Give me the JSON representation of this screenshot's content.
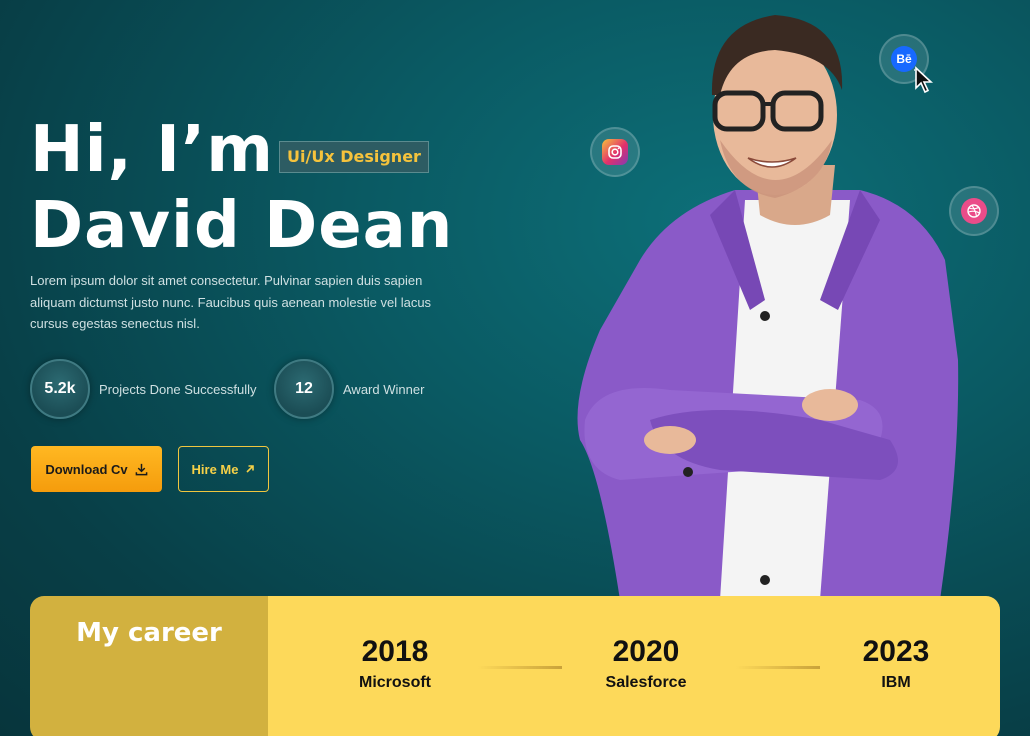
{
  "hero": {
    "greeting": "Hi, I’m",
    "name": "David Dean",
    "role": "Ui/Ux Designer",
    "intro": "Lorem ipsum dolor sit amet consectetur. Pulvinar sapien duis sapien aliquam dictumst justo nunc. Faucibus quis aenean molestie vel lacus cursus egestas senectus nisl."
  },
  "stats": [
    {
      "value": "5.2k",
      "label": "Projects Done Successfully"
    },
    {
      "value": "12",
      "label": "Award Winner"
    }
  ],
  "buttons": {
    "download": "Download Cv",
    "hire": "Hire Me"
  },
  "social": {
    "behance_label": "Bē"
  },
  "career": {
    "title": "My career",
    "milestones": [
      {
        "year": "2018",
        "company": "Microsoft"
      },
      {
        "year": "2020",
        "company": "Salesforce"
      },
      {
        "year": "2023",
        "company": "IBM"
      }
    ]
  },
  "colors": {
    "accent_yellow": "#fdd95a",
    "accent_orange": "#f59c0c",
    "background": "#0a5a63",
    "shirt_purple": "#8a5ac8"
  }
}
